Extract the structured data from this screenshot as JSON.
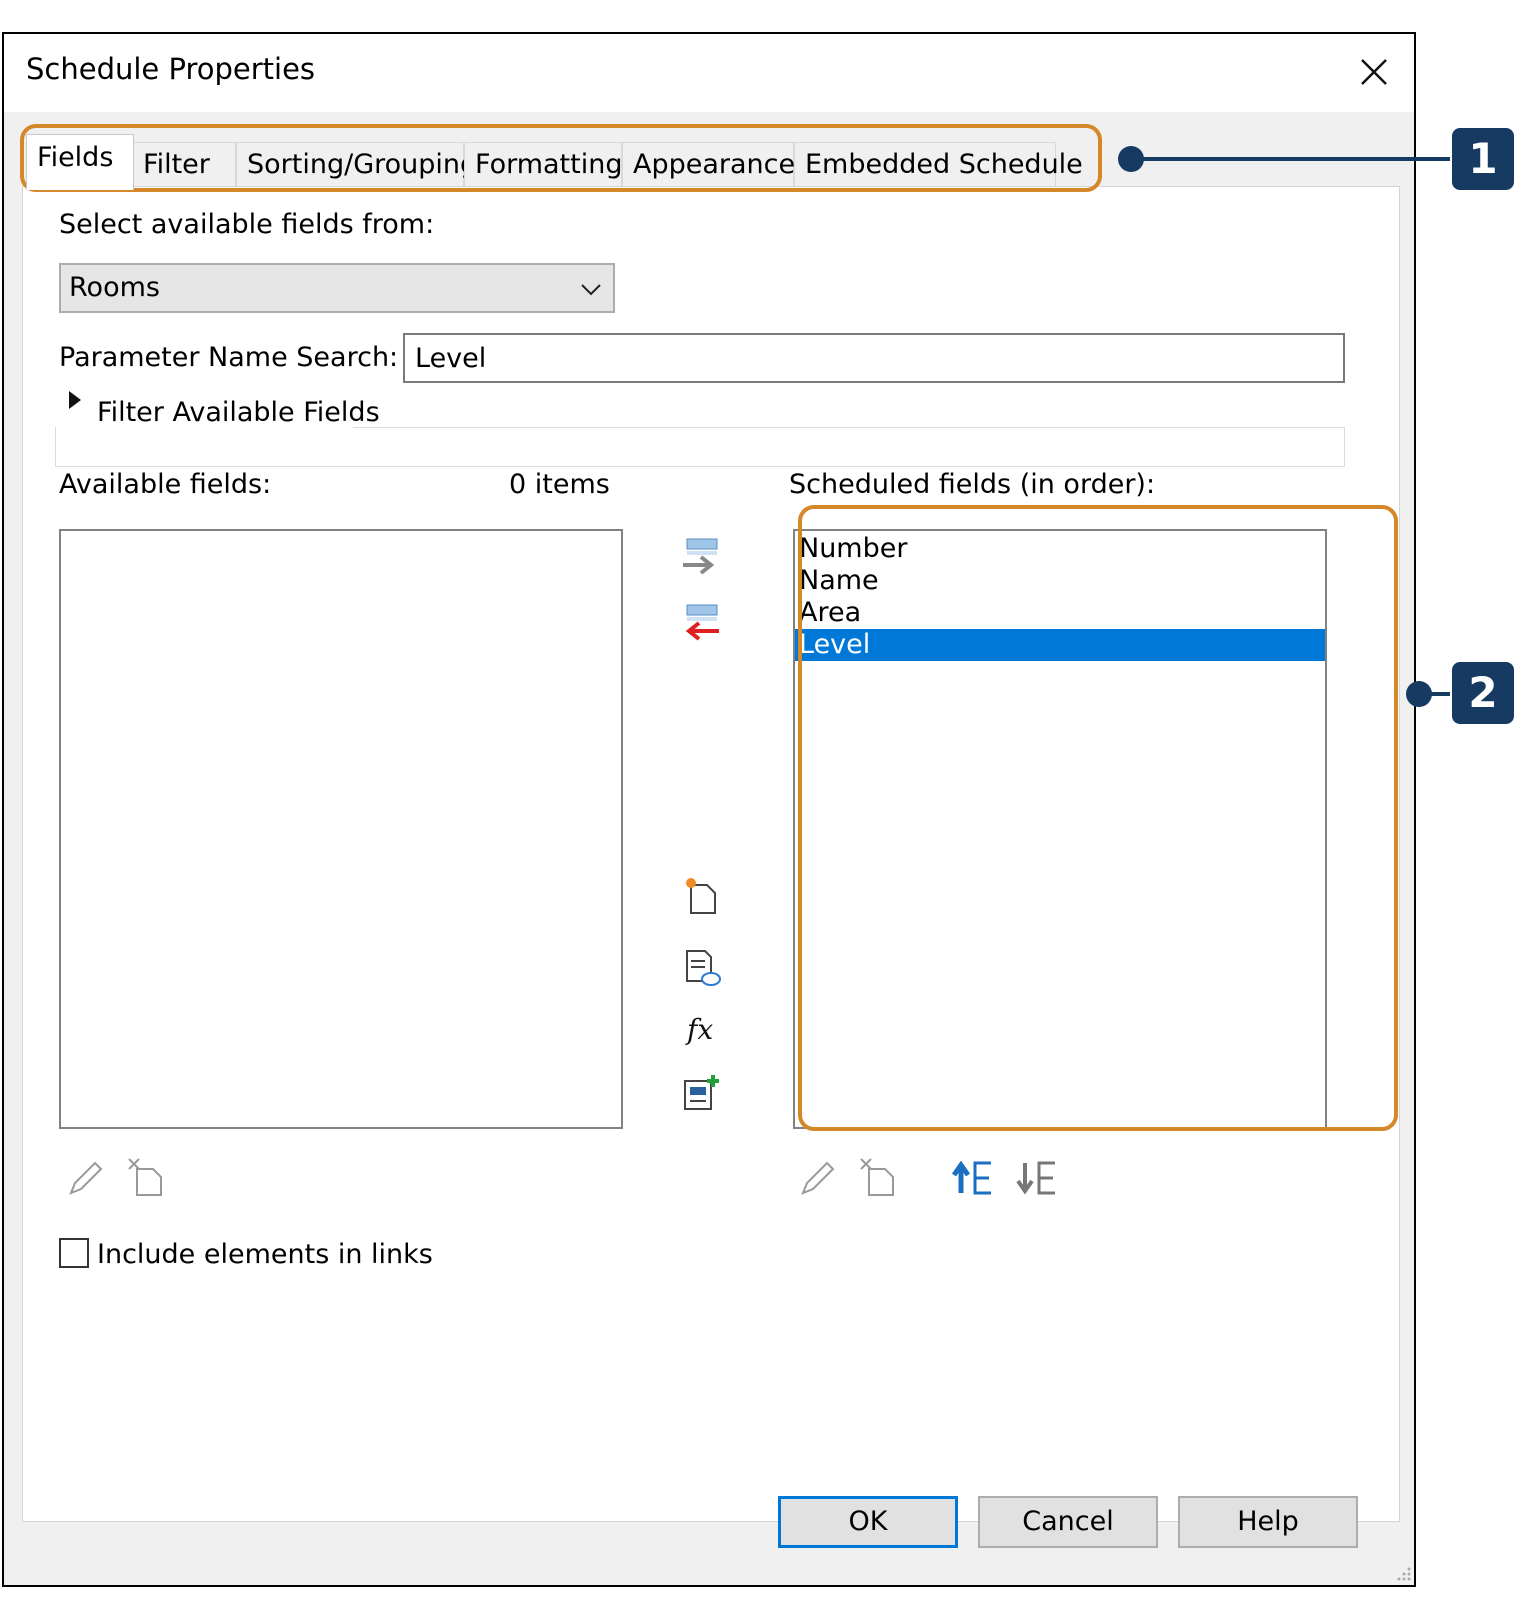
{
  "dialog": {
    "title": "Schedule Properties"
  },
  "tabs": [
    {
      "label": "Fields",
      "active": true
    },
    {
      "label": "Filter",
      "active": false
    },
    {
      "label": "Sorting/Grouping",
      "active": false
    },
    {
      "label": "Formatting",
      "active": false
    },
    {
      "label": "Appearance",
      "active": false
    },
    {
      "label": "Embedded Schedule",
      "active": false
    }
  ],
  "fields_tab": {
    "select_from_label": "Select available fields from:",
    "select_from_value": "Rooms",
    "param_search_label": "Parameter Name Search:",
    "param_search_value": "Level",
    "filter_expander_label": "Filter Available Fields",
    "available_label": "Available fields:",
    "available_count": "0 items",
    "available_items": [],
    "scheduled_label": "Scheduled fields (in order):",
    "scheduled_items": [
      "Number",
      "Name",
      "Area",
      "Level"
    ],
    "scheduled_selected": "Level",
    "include_links_label": "Include elements in links",
    "include_links_checked": false
  },
  "icons": {
    "add_parameter": "add-parameter-icon",
    "remove_parameter": "remove-parameter-icon",
    "new_parameter": "new-parameter-icon",
    "shared_parameter": "shared-parameter-icon",
    "calculated_value": "calculated-value-icon",
    "combine_parameters": "combine-parameters-icon",
    "edit": "pencil-icon",
    "delete": "delete-parameter-icon",
    "move_up": "move-up-icon",
    "move_down": "move-down-icon",
    "close": "close-icon",
    "expander": "expand-triangle-icon",
    "dropdown": "chevron-down-icon"
  },
  "buttons": {
    "ok": "OK",
    "cancel": "Cancel",
    "help": "Help"
  },
  "callouts": {
    "tabs_number": "1",
    "scheduled_number": "2",
    "frame_color": "#d4882a",
    "badge_color": "#173a63"
  },
  "colors": {
    "selection": "#0078d7",
    "dialog_bg": "#f0f0f0"
  }
}
